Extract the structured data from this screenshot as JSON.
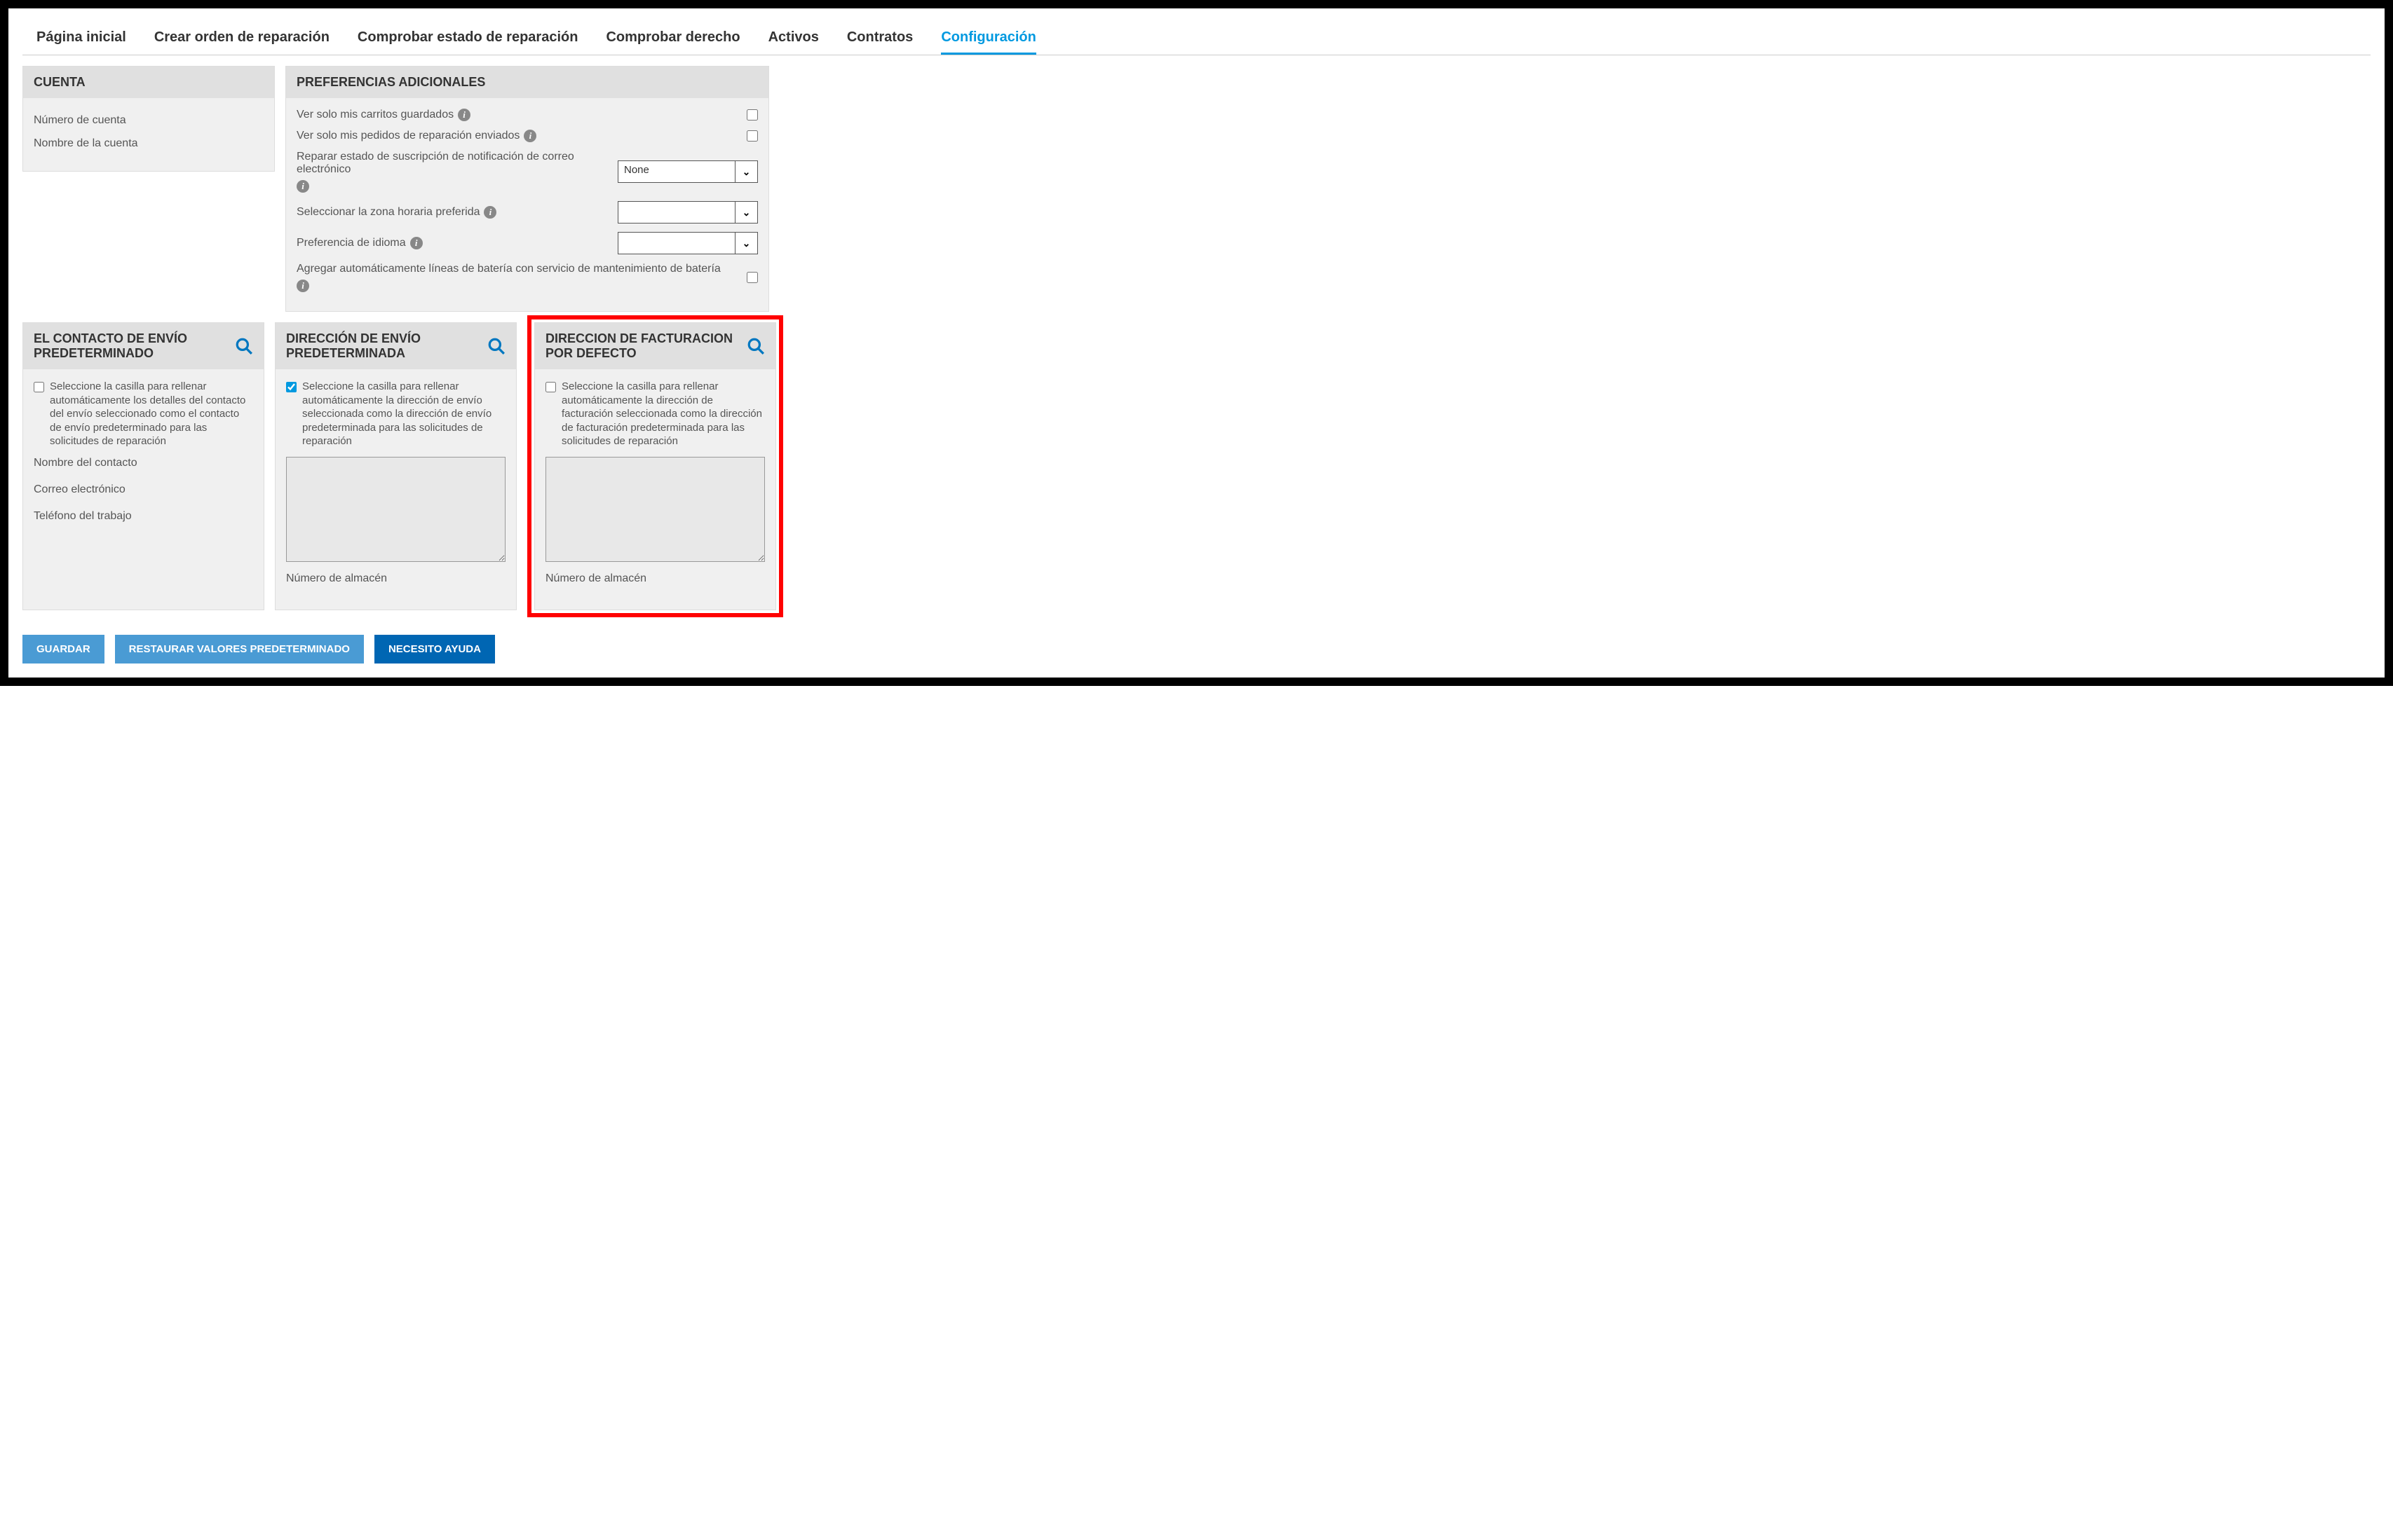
{
  "tabs": {
    "home": "Página inicial",
    "create": "Crear orden de reparación",
    "status": "Comprobar estado de reparación",
    "entitlement": "Comprobar derecho",
    "assets": "Activos",
    "contracts": "Contratos",
    "config": "Configuración"
  },
  "account": {
    "header": "CUENTA",
    "number_label": "Número de cuenta",
    "name_label": "Nombre de la cuenta"
  },
  "prefs": {
    "header": "PREFERENCIAS ADICIONALES",
    "carts_label": "Ver solo mis carritos guardados",
    "orders_label": "Ver solo mis pedidos de reparación enviados",
    "email_label": "Reparar estado de suscripción de notificación de correo electrónico",
    "email_value": "None",
    "tz_label": "Seleccionar la zona horaria preferida",
    "tz_value": "",
    "lang_label": "Preferencia de idioma",
    "lang_value": "",
    "battery_label": "Agregar automáticamente líneas de batería con servicio de mantenimiento de batería"
  },
  "contact": {
    "header": "EL CONTACTO DE ENVÍO PREDETERMINADO",
    "checkbox_text": "Seleccione la casilla para rellenar automáticamente los detalles del contacto del envío seleccionado como el contacto de envío predeterminado para las solicitudes de reparación",
    "name_label": "Nombre del contacto",
    "email_label": "Correo electrónico",
    "phone_label": "Teléfono del trabajo"
  },
  "ship": {
    "header": "DIRECCIÓN DE ENVÍO PREDETERMINADA",
    "checkbox_text": "Seleccione la casilla para rellenar automáticamente la dirección de envío seleccionada como la dirección de envío predeterminada para las solicitudes de reparación",
    "warehouse_label": "Número de almacén"
  },
  "bill": {
    "header": "DIRECCION DE FACTURACION POR DEFECTO",
    "checkbox_text": "Seleccione la casilla para rellenar automáticamente la dirección de facturación seleccionada como la dirección de facturación predeterminada para las solicitudes de reparación",
    "warehouse_label": "Número de almacén"
  },
  "buttons": {
    "save": "GUARDAR",
    "restore": "RESTAURAR VALORES PREDETERMINADO",
    "help": "NECESITO AYUDA"
  }
}
